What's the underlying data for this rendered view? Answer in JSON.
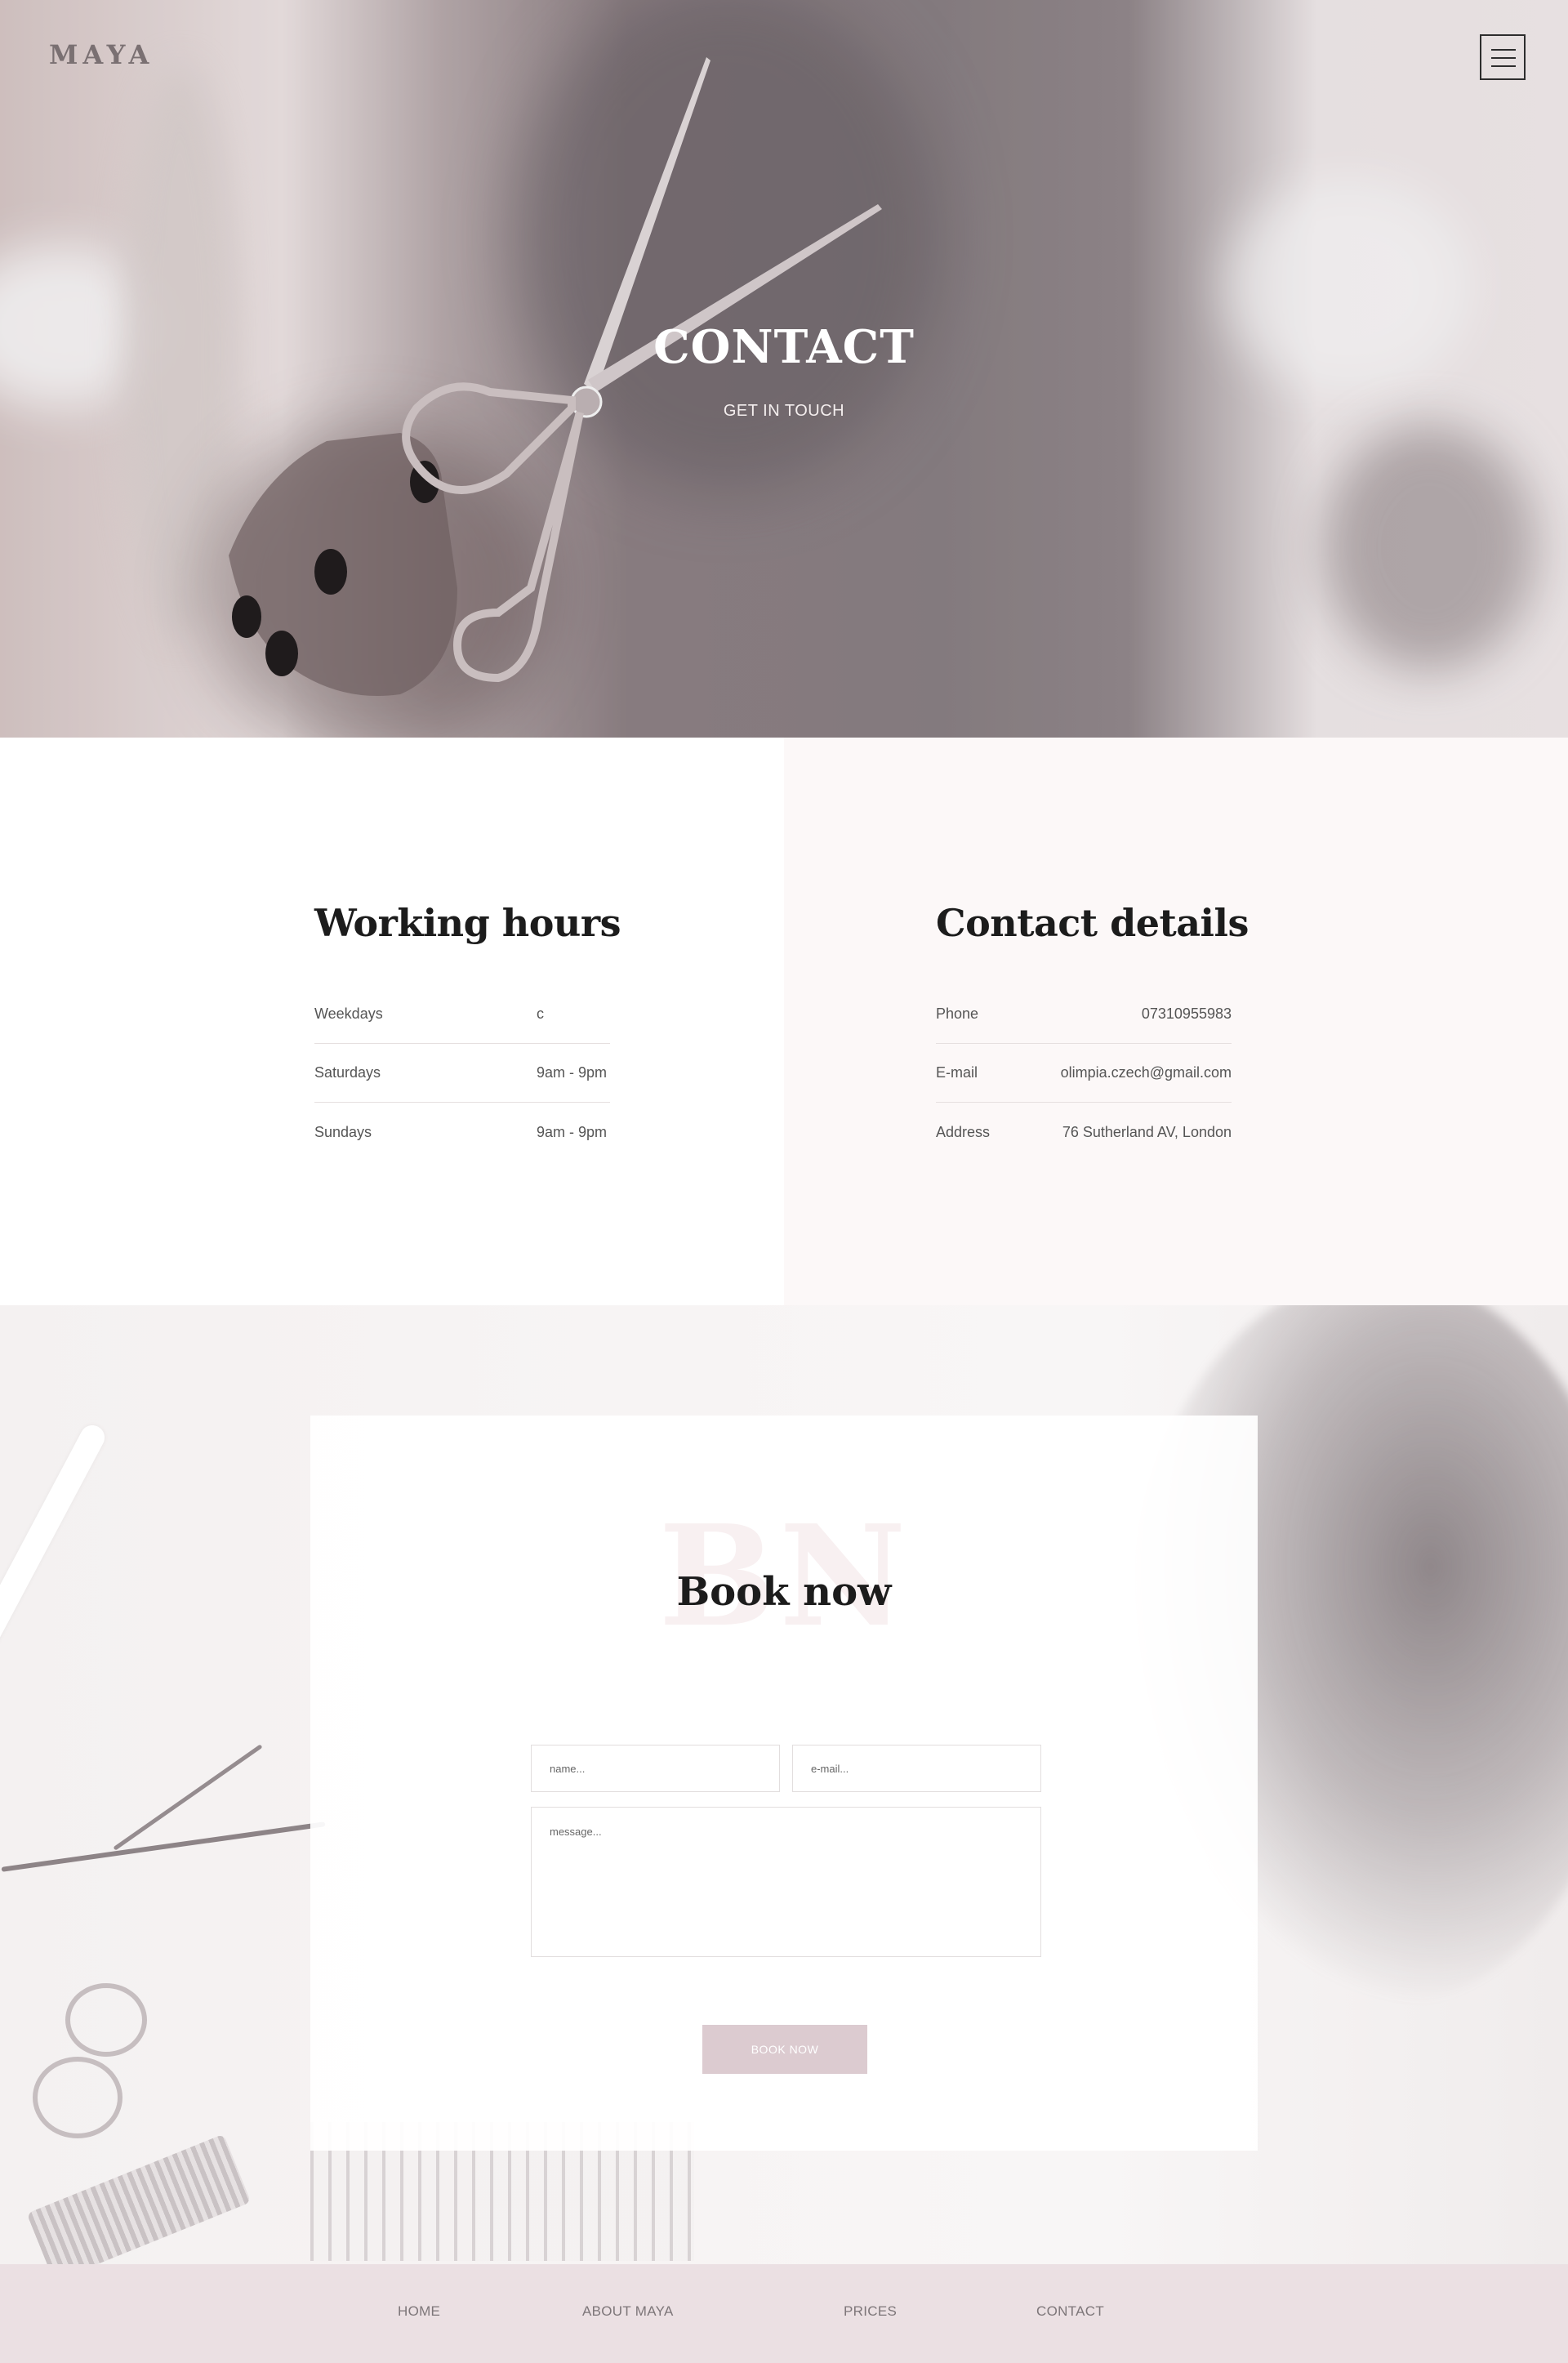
{
  "header": {
    "logo": "MAYA",
    "menu_icon": "hamburger-menu-icon"
  },
  "hero": {
    "title": "CONTACT",
    "subtitle": "GET IN TOUCH"
  },
  "working_hours": {
    "title": "Working hours",
    "rows": [
      {
        "label": "Weekdays",
        "value": "c"
      },
      {
        "label": "Saturdays",
        "value": "9am - 9pm"
      },
      {
        "label": "Sundays",
        "value": "9am - 9pm"
      }
    ]
  },
  "contact_details": {
    "title": "Contact details",
    "rows": [
      {
        "label": "Phone",
        "value": "07310955983"
      },
      {
        "label": "E-mail",
        "value": "olimpia.czech@gmail.com"
      },
      {
        "label": "Address",
        "value": "76 Sutherland AV, London"
      }
    ]
  },
  "booking": {
    "ghost_text": "BN",
    "title": "Book now",
    "name_placeholder": "name...",
    "email_placeholder": "e-mail...",
    "message_placeholder": "message...",
    "button_label": "BOOK NOW"
  },
  "footer": {
    "links": [
      "HOME",
      "ABOUT MAYA",
      "PRICES",
      "CONTACT"
    ]
  },
  "colors": {
    "accent": "#dccbd0",
    "footer_bg": "#ebe0e3",
    "heading": "#1c1c1c"
  }
}
